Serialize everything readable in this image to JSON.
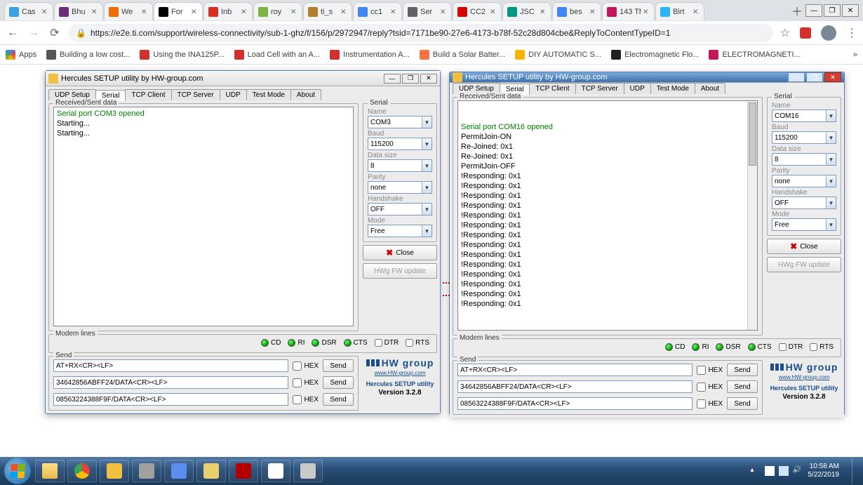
{
  "browser": {
    "tabs": [
      {
        "title": "Cas",
        "favColor": "#3aa3e3"
      },
      {
        "title": "Bhu",
        "favColor": "#6b2e7a"
      },
      {
        "title": "We",
        "favColor": "#ef6c00"
      },
      {
        "title": "For",
        "favColor": "#000000",
        "active": true
      },
      {
        "title": "Inb",
        "favColor": "#d93025"
      },
      {
        "title": "roy",
        "favColor": "#7cb342"
      },
      {
        "title": "ti_s",
        "favColor": "#b08030"
      },
      {
        "title": "cc1",
        "favColor": "#4285f4"
      },
      {
        "title": "Ser",
        "favColor": "#5f6368"
      },
      {
        "title": "CC2",
        "favColor": "#d50000"
      },
      {
        "title": "JSC",
        "favColor": "#009688"
      },
      {
        "title": "bes",
        "favColor": "#4285f4"
      },
      {
        "title": "The",
        "favColor": "#c2185b",
        "badge": "143"
      },
      {
        "title": "Birt",
        "favColor": "#29b6f6"
      }
    ],
    "url": "https://e2e.ti.com/support/wireless-connectivity/sub-1-ghz/f/156/p/2972947/reply?tsid=7171be90-27e6-4173-b78f-52c28d804cbe&ReplyToContentTypeID=1",
    "bookmarks": [
      {
        "label": "Apps",
        "color": "#4285f4"
      },
      {
        "label": "Building a low cost...",
        "color": "#555"
      },
      {
        "label": "Using the INA125P...",
        "color": "#d32f2f"
      },
      {
        "label": "Load Cell with an A...",
        "color": "#d32f2f"
      },
      {
        "label": "Instrumentation A...",
        "color": "#d32f2f"
      },
      {
        "label": "Build a Solar Batter...",
        "color": "#ff7043"
      },
      {
        "label": "DIY AUTOMATIC S...",
        "color": "#ffb300"
      },
      {
        "label": "Electromagnetic Flo...",
        "color": "#212121"
      },
      {
        "label": "ELECTROMAGNETI...",
        "color": "#c2185b"
      }
    ]
  },
  "hercules_tabs": [
    "UDP Setup",
    "Serial",
    "TCP Client",
    "TCP Server",
    "UDP",
    "Test Mode",
    "About"
  ],
  "serial_labels": {
    "group": "Serial",
    "name": "Name",
    "baud": "Baud",
    "datasize": "Data size",
    "parity": "Parity",
    "handshake": "Handshake",
    "mode": "Mode",
    "close": "Close",
    "fw": "HWg FW update",
    "recv": "Received/Sent data",
    "modem": "Modem lines",
    "send": "Send",
    "hex": "HEX",
    "sendbtn": "Send",
    "cd": "CD",
    "ri": "RI",
    "dsr": "DSR",
    "cts": "CTS",
    "dtr": "DTR",
    "rts": "RTS"
  },
  "brand": {
    "name": "HW group",
    "url": "www.HW-group.com",
    "product": "Hercules SETUP utility",
    "version": "Version  3.2.8"
  },
  "left": {
    "title": "Hercules SETUP utility by HW-group.com",
    "terminal": [
      {
        "t": "Serial port COM3 opened",
        "c": "green"
      },
      {
        "t": "Starting..."
      },
      {
        "t": "Starting..."
      }
    ],
    "serial": {
      "name": "COM3",
      "baud": "115200",
      "datasize": "8",
      "parity": "none",
      "handshake": "OFF",
      "mode": "Free"
    },
    "send": [
      "AT+RX<CR><LF>",
      "34642856ABFF24/DATA<CR><LF>",
      "08563224388F9F/DATA<CR><LF>"
    ]
  },
  "right": {
    "title": "Hercules SETUP utility by HW-group.com",
    "terminal": [
      {
        "t": "Serial port COM16 opened",
        "c": "green"
      },
      {
        "t": "PermitJoin-ON"
      },
      {
        "t": "Re-Joined: 0x1"
      },
      {
        "t": "Re-Joined: 0x1"
      },
      {
        "t": "PermitJoin-OFF"
      },
      {
        "t": "!Responding: 0x1"
      },
      {
        "t": "!Responding: 0x1"
      },
      {
        "t": "!Responding: 0x1"
      },
      {
        "t": "!Responding: 0x1"
      },
      {
        "t": "!Responding: 0x1"
      },
      {
        "t": "!Responding: 0x1"
      },
      {
        "t": "!Responding: 0x1"
      },
      {
        "t": "!Responding: 0x1"
      },
      {
        "t": "!Responding: 0x1"
      },
      {
        "t": "!Responding: 0x1"
      },
      {
        "t": "!Responding: 0x1"
      },
      {
        "t": "!Responding: 0x1"
      },
      {
        "t": "!Responding: 0x1"
      },
      {
        "t": "!Responding: 0x1"
      }
    ],
    "serial": {
      "name": "COM16",
      "baud": "115200",
      "datasize": "8",
      "parity": "none",
      "handshake": "OFF",
      "mode": "Free"
    },
    "send": [
      "AT+RX<CR><LF>",
      "34642856ABFF24/DATA<CR><LF>",
      "08563224388F9F/DATA<CR><LF>"
    ]
  },
  "taskbar": {
    "time": "10:58 AM",
    "date": "5/22/2019"
  }
}
